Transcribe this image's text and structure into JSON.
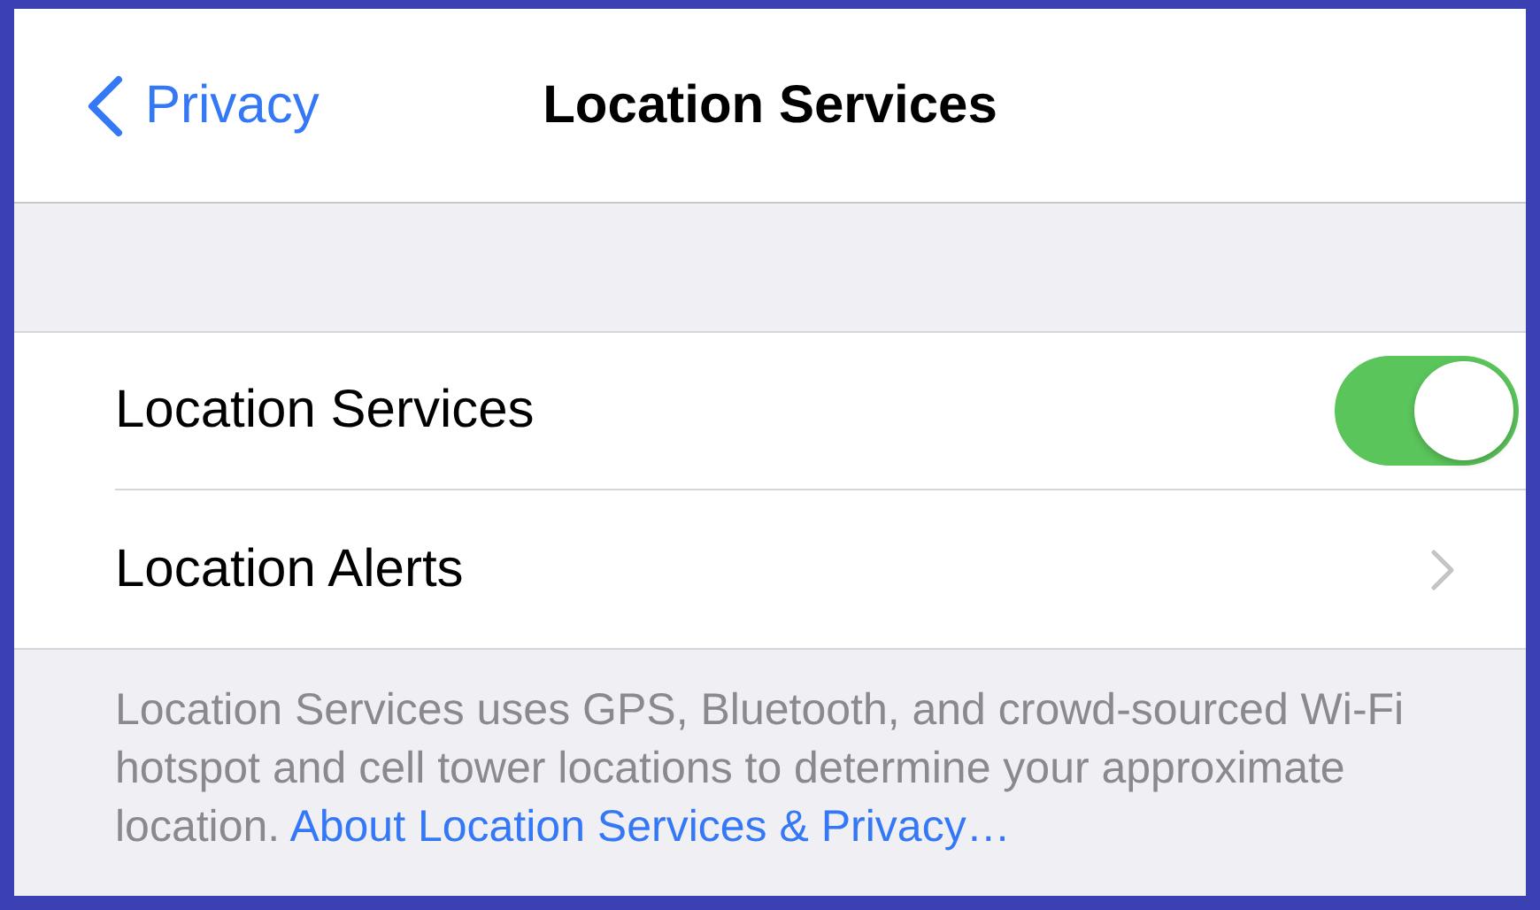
{
  "nav": {
    "back_label": "Privacy",
    "title": "Location Services"
  },
  "rows": [
    {
      "kind": "toggle",
      "label": "Location Services",
      "on": true
    },
    {
      "kind": "disclosure",
      "label": "Location Alerts"
    }
  ],
  "footer": {
    "text": "Location Services uses GPS, Bluetooth, and crowd-sourced Wi-Fi hotspot and cell tower locations to determine your approximate location.",
    "link": "About Location Services & Privacy…"
  }
}
